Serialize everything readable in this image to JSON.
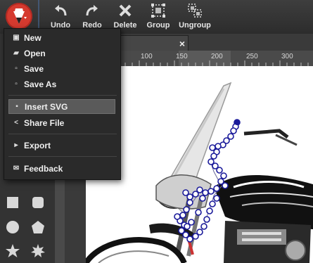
{
  "toolbar": {
    "buttons": [
      {
        "label": "Undo",
        "icon": "undo-icon"
      },
      {
        "label": "Redo",
        "icon": "redo-icon"
      },
      {
        "label": "Delete",
        "icon": "delete-icon"
      },
      {
        "label": "Group",
        "icon": "group-icon"
      },
      {
        "label": "Ungroup",
        "icon": "ungroup-icon"
      }
    ]
  },
  "menu": {
    "items": [
      {
        "label": "New",
        "icon": "file-new-icon"
      },
      {
        "label": "Open",
        "icon": "folder-open-icon"
      },
      {
        "label": "Save",
        "icon": "save-icon"
      },
      {
        "label": "Save As",
        "icon": "save-as-icon"
      },
      {
        "label": "Insert SVG",
        "icon": "insert-svg-icon",
        "selected": true
      },
      {
        "label": "Share File",
        "icon": "share-icon"
      },
      {
        "label": "Export",
        "icon": "export-icon"
      },
      {
        "label": "Feedback",
        "icon": "mail-icon"
      }
    ]
  },
  "ruler": {
    "labels": [
      "100",
      "150",
      "200",
      "250",
      "300"
    ]
  },
  "colors": {
    "accent": "#d53a2f",
    "node_stroke": "#1a1a9a",
    "menu_bg": "#2a2a2a",
    "selected_item": "#5a5a5a"
  }
}
